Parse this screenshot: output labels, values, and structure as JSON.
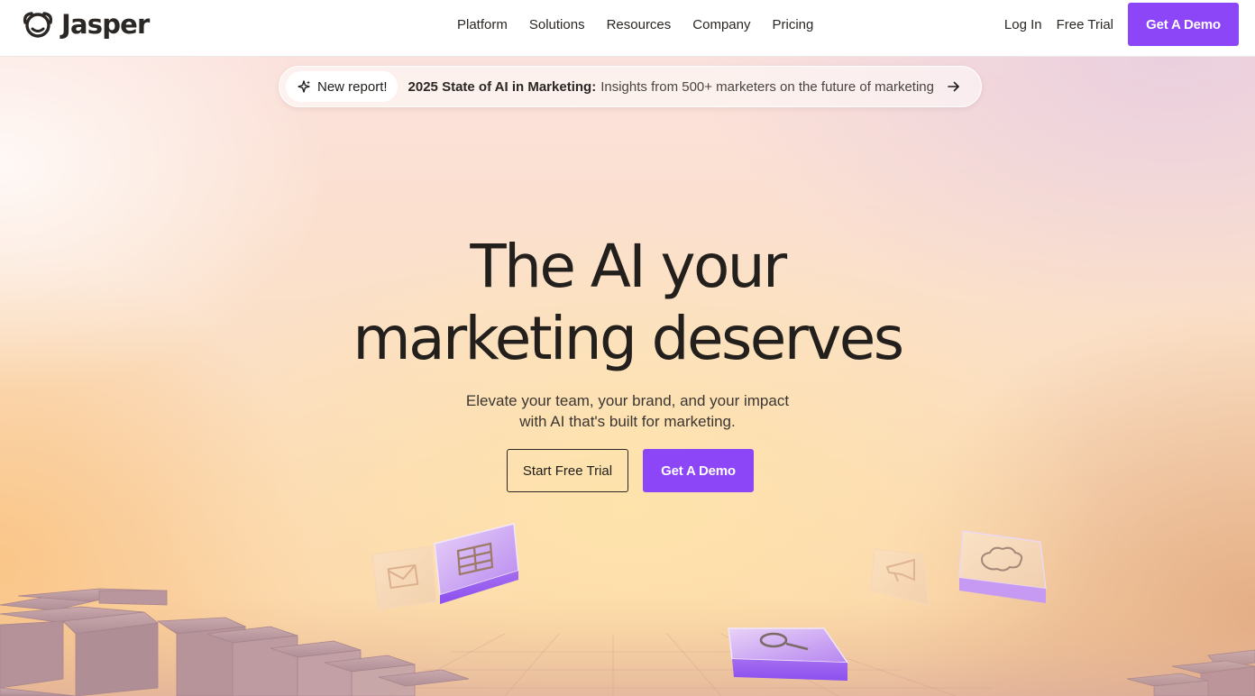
{
  "brand": {
    "name": "Jasper",
    "logo_icon": "jasper-face-icon"
  },
  "nav": {
    "links": [
      "Platform",
      "Solutions",
      "Resources",
      "Company",
      "Pricing"
    ],
    "login": "Log In",
    "free_trial": "Free Trial",
    "demo": "Get A Demo"
  },
  "announcement": {
    "badge_icon": "sparkle-icon",
    "badge": "New report!",
    "title": "2025 State of AI in Marketing:",
    "text": "Insights from 500+ marketers on the future of marketing",
    "arrow_icon": "arrow-right-icon"
  },
  "hero": {
    "headline_line1": "The AI your",
    "headline_line2": "marketing deserves",
    "subtext_line1": "Elevate your team, your brand, and your impact",
    "subtext_line2": "with AI that's built for marketing.",
    "cta_trial": "Start Free Trial",
    "cta_demo": "Get A Demo"
  },
  "decor_icons": [
    "mail-icon",
    "table-icon",
    "search-icon",
    "megaphone-icon",
    "salesforce-icon"
  ],
  "colors": {
    "accent": "#8c45f7",
    "text": "#1f1d1a",
    "block": "#b89aa0"
  }
}
